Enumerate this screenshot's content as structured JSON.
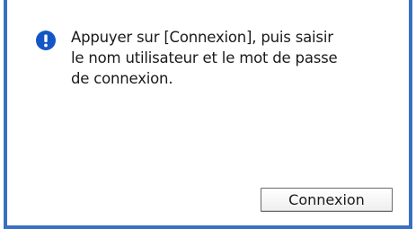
{
  "dialog": {
    "message_lines": [
      "Appuyer sur [Connexion], puis saisir",
      "le nom utilisateur et le mot de passe",
      "de connexion."
    ],
    "login_button_label": "Connexion",
    "icon": "exclamation-info-icon"
  },
  "colors": {
    "frame_border": "#3a6fc1",
    "icon_fill": "#1556c7",
    "background": "#ffffff"
  }
}
